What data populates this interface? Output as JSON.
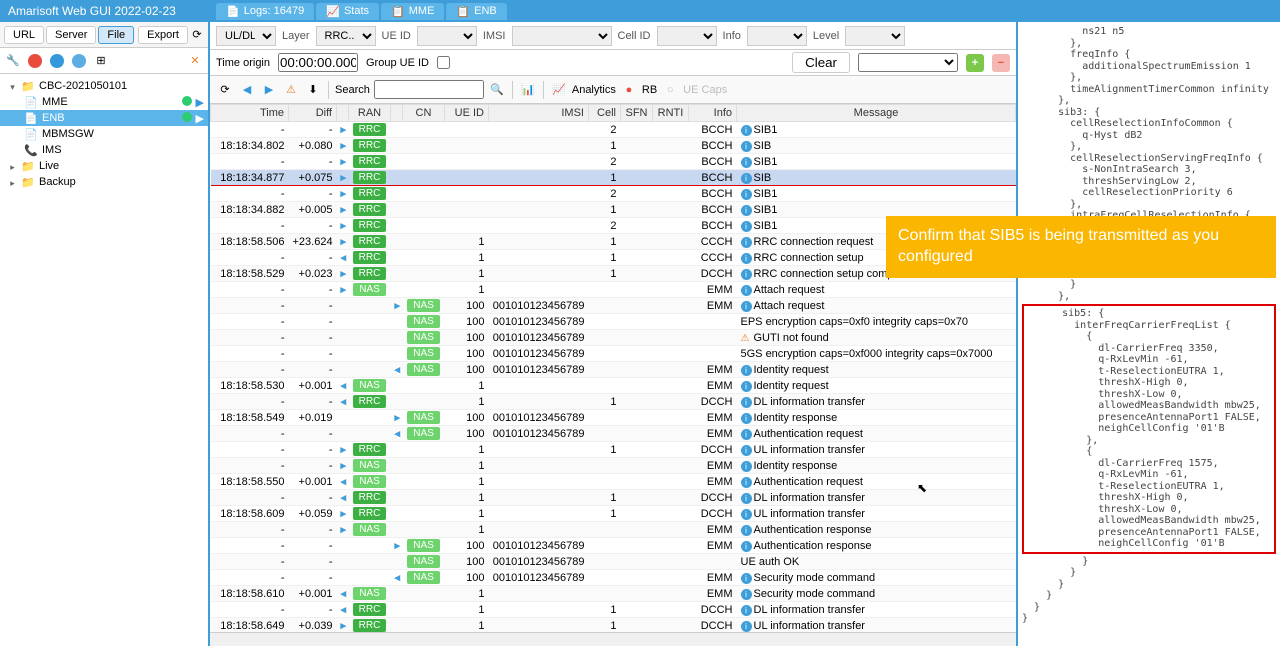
{
  "app": {
    "title": "Amarisoft Web GUI 2022-02-23"
  },
  "toptabs": [
    {
      "label": "Logs: 16479",
      "icon": "logs"
    },
    {
      "label": "Stats",
      "icon": "stats"
    },
    {
      "label": "MME",
      "icon": "mme"
    },
    {
      "label": "ENB",
      "icon": "enb"
    }
  ],
  "sidebar": {
    "buttons": {
      "url": "URL",
      "server": "Server",
      "file": "File",
      "export": "Export"
    },
    "tree": {
      "root": "CBC-2021050101",
      "items": [
        {
          "label": "MME"
        },
        {
          "label": "ENB",
          "selected": true
        },
        {
          "label": "MBMSGW"
        },
        {
          "label": "IMS"
        }
      ],
      "live": "Live",
      "backup": "Backup"
    }
  },
  "filters": {
    "uldl": "UL/DL",
    "layer_label": "Layer",
    "layer": "RRC..",
    "ueid_label": "UE ID",
    "imsi_label": "IMSI",
    "cellid_label": "Cell ID",
    "info_label": "Info",
    "level_label": "Level"
  },
  "second": {
    "time_origin_label": "Time origin",
    "time_origin": "00:00:00.000",
    "group_label": "Group UE ID",
    "clear": "Clear"
  },
  "third": {
    "search_label": "Search",
    "analytics": "Analytics",
    "rb": "RB",
    "uecaps": "UE Caps"
  },
  "columns": [
    "Time",
    "Diff",
    "",
    "RAN",
    "",
    "CN",
    "UE ID",
    "IMSI",
    "Cell",
    "SFN",
    "RNTI",
    "Info",
    "Message"
  ],
  "rows": [
    {
      "time": "-",
      "diff": "-",
      "dir": "▸",
      "ran": "RRC",
      "cell": "2",
      "info": "BCCH",
      "icon": "i",
      "msg": "SIB1"
    },
    {
      "time": "18:18:34.802",
      "diff": "+0.080",
      "dir": "▸",
      "ran": "RRC",
      "cell": "1",
      "info": "BCCH",
      "icon": "i",
      "msg": "SIB"
    },
    {
      "time": "-",
      "diff": "-",
      "dir": "▸",
      "ran": "RRC",
      "cell": "2",
      "info": "BCCH",
      "icon": "i",
      "msg": "SIB1"
    },
    {
      "time": "18:18:34.877",
      "diff": "+0.075",
      "dir": "▸",
      "ran": "RRC",
      "cell": "1",
      "info": "BCCH",
      "icon": "i",
      "msg": "SIB",
      "selected": true,
      "highlighted": true
    },
    {
      "time": "-",
      "diff": "-",
      "dir": "▸",
      "ran": "RRC",
      "cell": "2",
      "info": "BCCH",
      "icon": "i",
      "msg": "SIB1"
    },
    {
      "time": "18:18:34.882",
      "diff": "+0.005",
      "dir": "▸",
      "ran": "RRC",
      "cell": "1",
      "info": "BCCH",
      "icon": "i",
      "msg": "SIB1"
    },
    {
      "time": "-",
      "diff": "-",
      "dir": "▸",
      "ran": "RRC",
      "cell": "2",
      "info": "BCCH",
      "icon": "i",
      "msg": "SIB1"
    },
    {
      "time": "18:18:58.506",
      "diff": "+23.624",
      "dir": "▸",
      "ran": "RRC",
      "ueid": "1",
      "cell": "1",
      "info": "CCCH",
      "icon": "i",
      "msg": "RRC connection request"
    },
    {
      "time": "-",
      "diff": "-",
      "dir": "◂",
      "ran": "RRC",
      "ueid": "1",
      "cell": "1",
      "info": "CCCH",
      "icon": "i",
      "msg": "RRC connection setup"
    },
    {
      "time": "18:18:58.529",
      "diff": "+0.023",
      "dir": "▸",
      "ran": "RRC",
      "ueid": "1",
      "cell": "1",
      "info": "DCCH",
      "icon": "i",
      "msg": "RRC connection setup complete"
    },
    {
      "time": "-",
      "diff": "-",
      "dir": "▸",
      "ran": "NAS",
      "ueid": "1",
      "info": "EMM",
      "icon": "i",
      "msg": "Attach request"
    },
    {
      "time": "-",
      "diff": "-",
      "dir2": "▸",
      "cn": "NAS",
      "ueid": "100",
      "imsi": "001010123456789",
      "info": "EMM",
      "icon": "i",
      "msg": "Attach request"
    },
    {
      "time": "-",
      "diff": "-",
      "cn": "NAS",
      "ueid": "100",
      "imsi": "001010123456789",
      "msg": "EPS encryption caps=0xf0 integrity caps=0x70"
    },
    {
      "time": "-",
      "diff": "-",
      "cn": "NAS",
      "ueid": "100",
      "imsi": "001010123456789",
      "icon": "w",
      "msg": "GUTI not found"
    },
    {
      "time": "-",
      "diff": "-",
      "cn": "NAS",
      "ueid": "100",
      "imsi": "001010123456789",
      "msg": "5GS encryption caps=0xf000 integrity caps=0x7000"
    },
    {
      "time": "-",
      "diff": "-",
      "dir2": "◂",
      "cn": "NAS",
      "ueid": "100",
      "imsi": "001010123456789",
      "info": "EMM",
      "icon": "i",
      "msg": "Identity request"
    },
    {
      "time": "18:18:58.530",
      "diff": "+0.001",
      "dir": "◂",
      "ran": "NAS",
      "ueid": "1",
      "info": "EMM",
      "icon": "i",
      "msg": "Identity request"
    },
    {
      "time": "-",
      "diff": "-",
      "dir": "◂",
      "ran": "RRC",
      "ueid": "1",
      "cell": "1",
      "info": "DCCH",
      "icon": "i",
      "msg": "DL information transfer"
    },
    {
      "time": "18:18:58.549",
      "diff": "+0.019",
      "dir2": "▸",
      "cn": "NAS",
      "ueid": "100",
      "imsi": "001010123456789",
      "info": "EMM",
      "icon": "i",
      "msg": "Identity response"
    },
    {
      "time": "-",
      "diff": "-",
      "dir2": "◂",
      "cn": "NAS",
      "ueid": "100",
      "imsi": "001010123456789",
      "info": "EMM",
      "icon": "i",
      "msg": "Authentication request"
    },
    {
      "time": "-",
      "diff": "-",
      "dir": "▸",
      "ran": "RRC",
      "ueid": "1",
      "cell": "1",
      "info": "DCCH",
      "icon": "i",
      "msg": "UL information transfer"
    },
    {
      "time": "-",
      "diff": "-",
      "dir": "▸",
      "ran": "NAS",
      "ueid": "1",
      "info": "EMM",
      "icon": "i",
      "msg": "Identity response"
    },
    {
      "time": "18:18:58.550",
      "diff": "+0.001",
      "dir": "◂",
      "ran": "NAS",
      "ueid": "1",
      "info": "EMM",
      "icon": "i",
      "msg": "Authentication request"
    },
    {
      "time": "-",
      "diff": "-",
      "dir": "◂",
      "ran": "RRC",
      "ueid": "1",
      "cell": "1",
      "info": "DCCH",
      "icon": "i",
      "msg": "DL information transfer"
    },
    {
      "time": "18:18:58.609",
      "diff": "+0.059",
      "dir": "▸",
      "ran": "RRC",
      "ueid": "1",
      "cell": "1",
      "info": "DCCH",
      "icon": "i",
      "msg": "UL information transfer"
    },
    {
      "time": "-",
      "diff": "-",
      "dir": "▸",
      "ran": "NAS",
      "ueid": "1",
      "info": "EMM",
      "icon": "i",
      "msg": "Authentication response"
    },
    {
      "time": "-",
      "diff": "-",
      "dir2": "▸",
      "cn": "NAS",
      "ueid": "100",
      "imsi": "001010123456789",
      "info": "EMM",
      "icon": "i",
      "msg": "Authentication response"
    },
    {
      "time": "-",
      "diff": "-",
      "cn": "NAS",
      "ueid": "100",
      "imsi": "001010123456789",
      "msg": "UE auth OK"
    },
    {
      "time": "-",
      "diff": "-",
      "dir2": "◂",
      "cn": "NAS",
      "ueid": "100",
      "imsi": "001010123456789",
      "info": "EMM",
      "icon": "i",
      "msg": "Security mode command"
    },
    {
      "time": "18:18:58.610",
      "diff": "+0.001",
      "dir": "◂",
      "ran": "NAS",
      "ueid": "1",
      "info": "EMM",
      "icon": "i",
      "msg": "Security mode command"
    },
    {
      "time": "-",
      "diff": "-",
      "dir": "◂",
      "ran": "RRC",
      "ueid": "1",
      "cell": "1",
      "info": "DCCH",
      "icon": "i",
      "msg": "DL information transfer"
    },
    {
      "time": "18:18:58.649",
      "diff": "+0.039",
      "dir": "▸",
      "ran": "RRC",
      "ueid": "1",
      "cell": "1",
      "info": "DCCH",
      "icon": "i",
      "msg": "UL information transfer"
    }
  ],
  "tip": "Confirm that SIB5 is being transmitted as you configured",
  "code_top": "          ns21 n5\n        },\n        freqInfo {\n          additionalSpectrumEmission 1\n        },\n        timeAlignmentTimerCommon infinity\n      },\n      sib3: {\n        cellReselectionInfoCommon {\n          q-Hyst dB2\n        },\n        cellReselectionServingFreqInfo {\n          s-NonIntraSearch 3,\n          threshServingLow 2,\n          cellReselectionPriority 6\n        },\n        intraFreqCellReselectionInfo {\n\n\n\n\n          t-ReselectionEUTRA 1\n        }\n      },",
  "code_highlight": "      sib5: {\n        interFreqCarrierFreqList {\n          {\n            dl-CarrierFreq 3350,\n            q-RxLevMin -61,\n            t-ReselectionEUTRA 1,\n            threshX-High 0,\n            threshX-Low 0,\n            allowedMeasBandwidth mbw25,\n            presenceAntennaPort1 FALSE,\n            neighCellConfig '01'B\n          },\n          {\n            dl-CarrierFreq 1575,\n            q-RxLevMin -61,\n            t-ReselectionEUTRA 1,\n            threshX-High 0,\n            threshX-Low 0,\n            allowedMeasBandwidth mbw25,\n            presenceAntennaPort1 FALSE,\n            neighCellConfig '01'B",
  "code_bottom": "          }\n        }\n      }\n    }\n  }\n}"
}
